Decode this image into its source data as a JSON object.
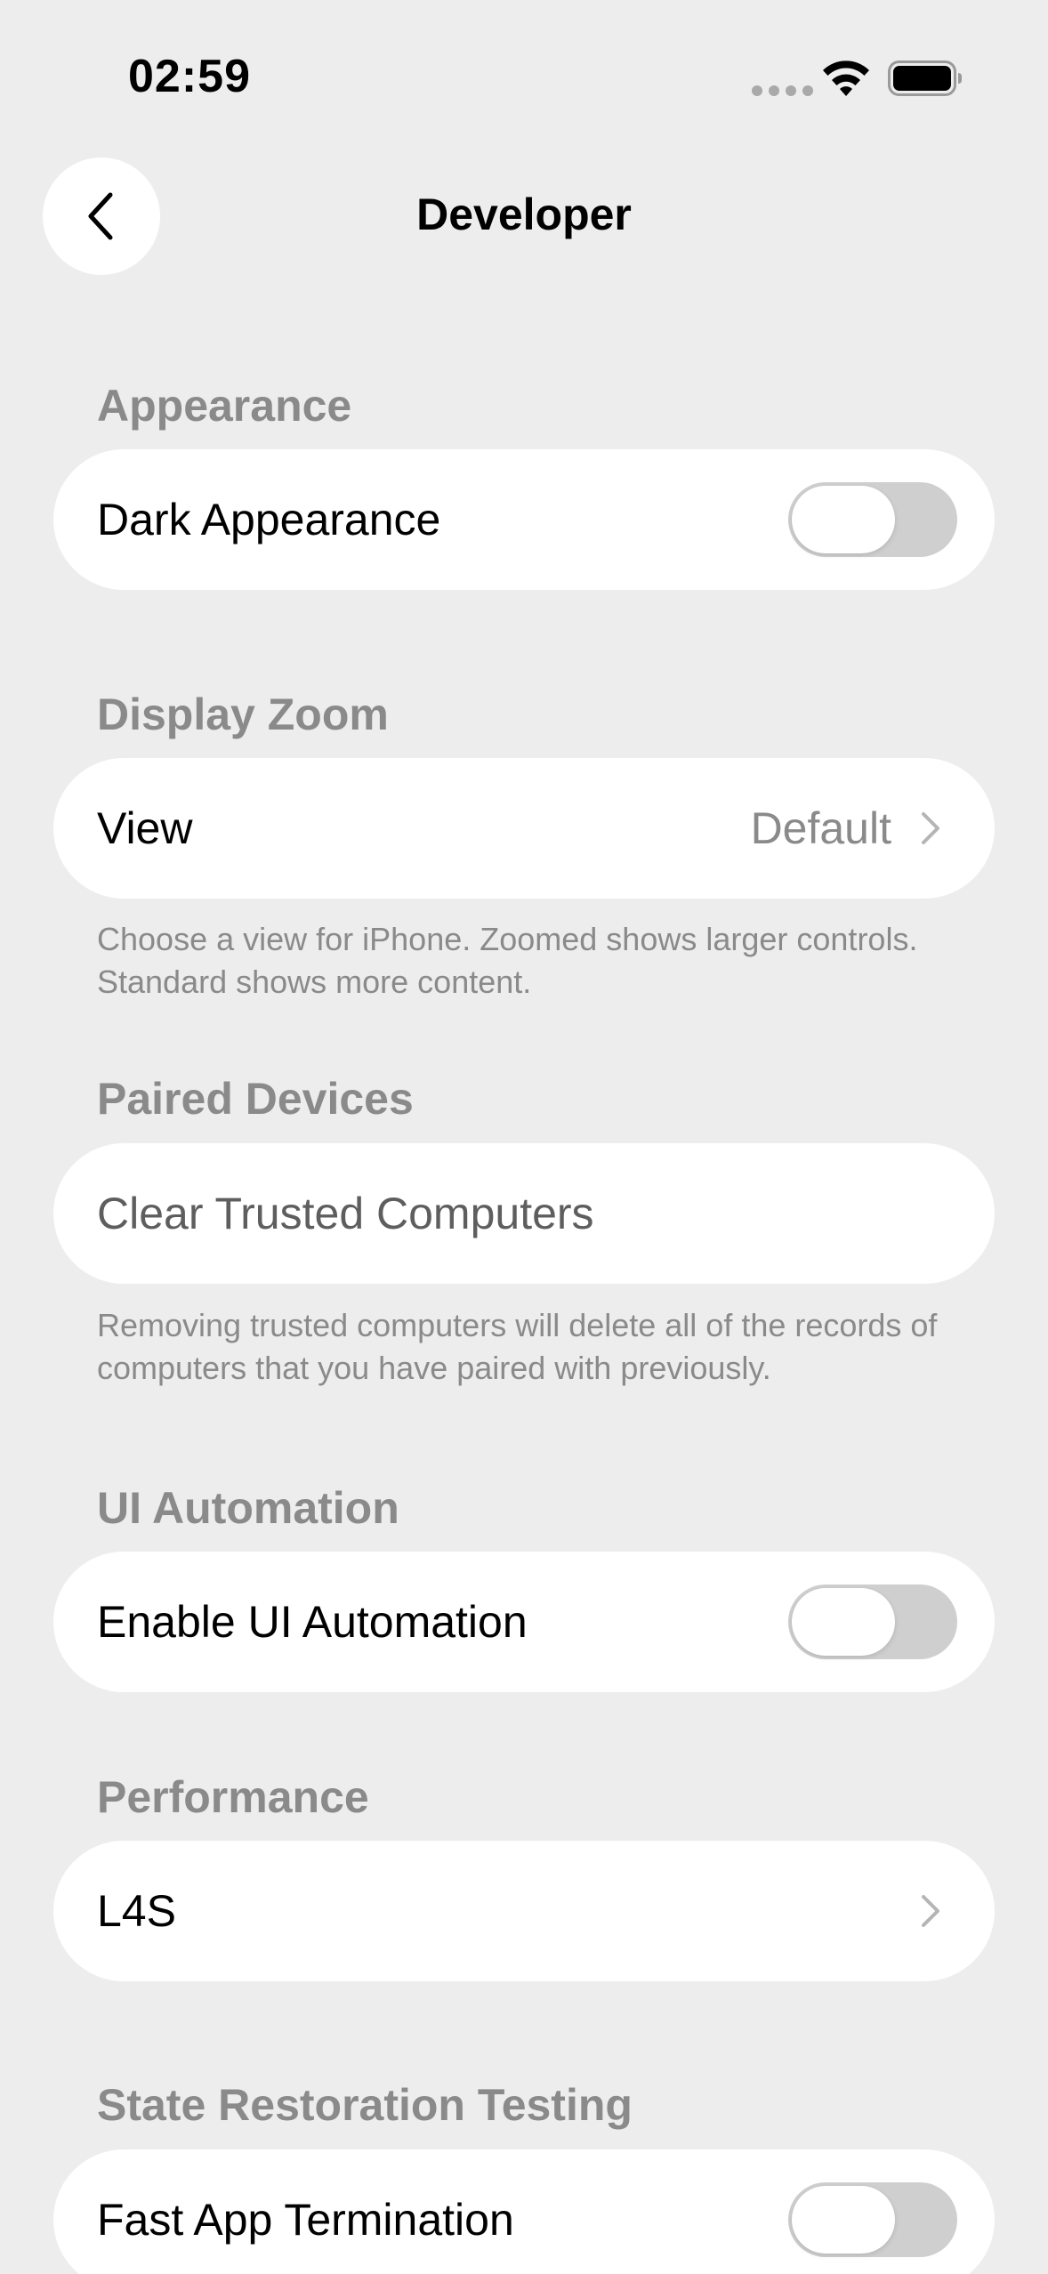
{
  "status_bar": {
    "time": "02:59",
    "icons": [
      "cellular-signal-icon",
      "wifi-icon",
      "battery-icon"
    ]
  },
  "nav": {
    "back_icon": "chevron-left-icon",
    "title": "Developer"
  },
  "sections": {
    "appearance": {
      "header": "Appearance",
      "row_label": "Dark Appearance",
      "toggle_on": false
    },
    "display_zoom": {
      "header": "Display Zoom",
      "row_label": "View",
      "row_value": "Default",
      "footnote": "Choose a view for iPhone. Zoomed shows larger controls. Standard shows more content."
    },
    "paired_devices": {
      "header": "Paired Devices",
      "row_label": "Clear Trusted Computers",
      "footnote": "Removing trusted computers will delete all of the records of computers that you have paired with previously."
    },
    "ui_automation": {
      "header": "UI Automation",
      "row_label": "Enable UI Automation",
      "toggle_on": false
    },
    "performance": {
      "header": "Performance",
      "row_label": "L4S"
    },
    "state_restoration": {
      "header": "State Restoration Testing",
      "row_label": "Fast App Termination",
      "toggle_on": false
    }
  },
  "colors": {
    "background": "#ededed",
    "card": "#ffffff",
    "secondary_text": "#8a8a8a",
    "toggle_off_track": "#cfcfcf"
  }
}
